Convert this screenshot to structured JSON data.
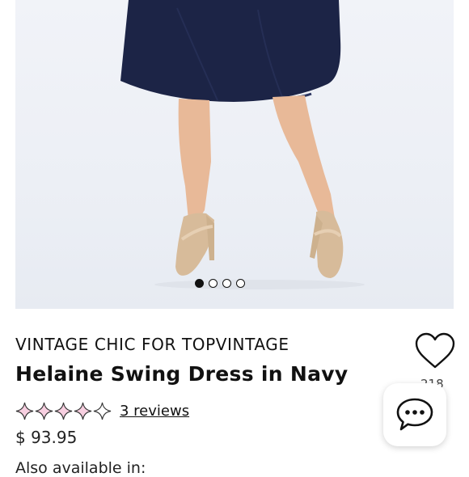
{
  "product": {
    "brand": "VINTAGE CHIC FOR TOPVINTAGE",
    "title": "Helaine Swing Dress in Navy",
    "price": "$ 93.95",
    "rating": 4,
    "rating_max": 5,
    "reviews_label": "3 reviews",
    "favorites_count": "218",
    "also_available": "Also available in:"
  },
  "gallery": {
    "image_count": 4,
    "active_index": 0,
    "image_alt": "Model wearing navy swing skirt with gold strappy heels"
  },
  "icons": {
    "favorite": "heart-icon",
    "chat": "chat-bubble-icon",
    "star": "sparkle-star-icon"
  },
  "colors": {
    "star_fill": "#f7cfe0",
    "star_stroke": "#333333",
    "navy": "#1c2446"
  }
}
